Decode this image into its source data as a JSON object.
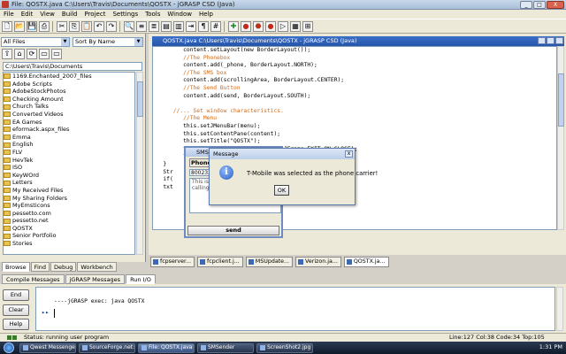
{
  "window": {
    "title": "File: QOSTX.java  C:\\Users\\Travis\\Documents\\QOSTX - jGRASP CSD (Java)",
    "min": "_",
    "max": "□",
    "close": "X"
  },
  "menu": [
    "File",
    "Edit",
    "View",
    "Build",
    "Project",
    "Settings",
    "Tools",
    "Window",
    "Help"
  ],
  "browse": {
    "filter": "All Files",
    "sort": "Sort By Name",
    "path": "C:\\Users\\Travis\\Documents",
    "items": [
      "1169.Enchanted_2007_files",
      "Adobe Scripts",
      "AdobeStockPhotos",
      "Checking Amount",
      "Church Talks",
      "Converted Videos",
      "EA Games",
      "eformack.aspx_files",
      "Emma",
      "English",
      "FLV",
      "HevTek",
      "ISO",
      "KeyWOrd",
      "Letters",
      "My Received Files",
      "My Sharing Folders",
      "MyEmsticons",
      "pessetto.com",
      "pessetto.net",
      "QOSTX",
      "Senior Portfolio",
      "Stories"
    ],
    "tabs": [
      "Browse",
      "Find",
      "Debug",
      "Workbench"
    ]
  },
  "editor": {
    "title": "QOSTX.java  C:\\Users\\Travis\\Documents\\QOSTX  -  jGRASP CSD (Java)",
    "lines": [
      {
        "t": "         content.setLayout(new BorderLayout());",
        "c": false
      },
      {
        "t": "         //The Phonebox",
        "c": true
      },
      {
        "t": "         content.add(_phone, BorderLayout.NORTH);",
        "c": false
      },
      {
        "t": "         //The SMS box",
        "c": true
      },
      {
        "t": "         content.add(scrollingArea, BorderLayout.CENTER);",
        "c": false
      },
      {
        "t": "         //The Send Button",
        "c": true
      },
      {
        "t": "         content.add(send, BorderLayout.SOUTH);",
        "c": false
      },
      {
        "t": "",
        "c": false
      },
      {
        "t": "      //... Set window characteristics.",
        "c": true
      },
      {
        "t": "         //The Menu",
        "c": true
      },
      {
        "t": "         this.setJMenuBar(menu);",
        "c": false
      },
      {
        "t": "         this.setContentPane(content);",
        "c": false
      },
      {
        "t": "         this.setTitle(\"QOSTX\");",
        "c": false
      },
      {
        "t": "         this.setDefaultCloseOperation(JFrame.EXIT_ON_CLOSE);",
        "c": false
      },
      {
        "t": "         this.pack();",
        "c": false
      },
      {
        "t": "   }",
        "c": false
      },
      {
        "t": "   Str",
        "c": false
      },
      {
        "t": "   if(",
        "c": false
      },
      {
        "t": "   txt",
        "c": false
      }
    ]
  },
  "windowTabs": [
    "fcpserver...",
    "fcpclient.j...",
    "MSUpdate...",
    "Verizon.ja...",
    "QOSTX.ja..."
  ],
  "messages": {
    "tabs": [
      "Compile Messages",
      "jGRASP Messages",
      "Run I/O"
    ],
    "buttons": [
      "End",
      "Clear",
      "Help"
    ],
    "output": "----jGRASP exec: java QOSTX"
  },
  "status": {
    "text": "Status: running user program",
    "position": "Line:127  Col:38  Code:34  Top:105"
  },
  "sms": {
    "title": "SMS",
    "phone_label": "Phone #",
    "number": "8002324...",
    "body": "This is a... so, it sou... by calling... Carrier m... openly.",
    "send": "send"
  },
  "dialog": {
    "title": "Message",
    "icon": "i",
    "message": "T-Mobile was selected as the phone carrier!",
    "ok": "OK",
    "close": "x"
  },
  "taskbar": {
    "items": [
      "Qwest Messenger b...",
      "SourceForge.net: Q...",
      "File: QOSTX.java  C...",
      "SMSender",
      "ScreenShot2.jpg - Pa..."
    ],
    "clock": "1:31 PM"
  }
}
